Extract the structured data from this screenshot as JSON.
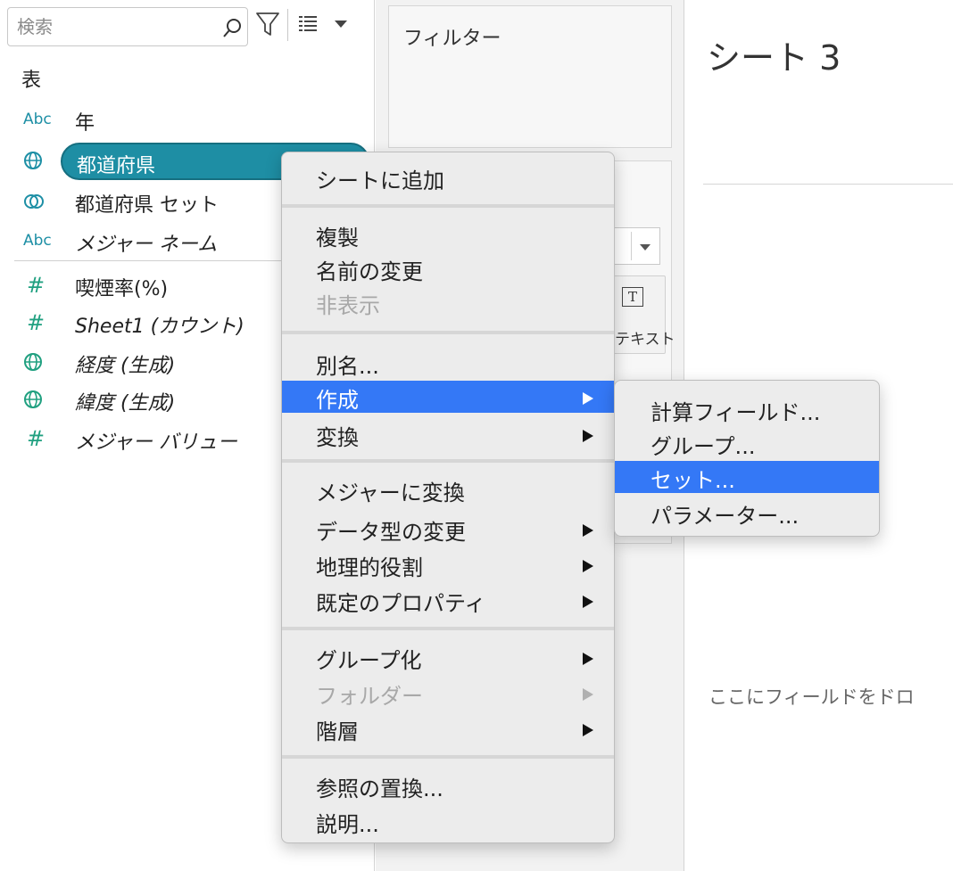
{
  "search": {
    "placeholder": "検索"
  },
  "data_pane": {
    "section_title": "表",
    "fields": [
      {
        "icon": "Abc",
        "label": "年",
        "italic": false
      },
      {
        "icon": "globe",
        "label": "都道府県",
        "italic": false,
        "selected": true
      },
      {
        "icon": "set",
        "label": "都道府県 セット",
        "italic": false
      },
      {
        "icon": "Abc",
        "label": "メジャー ネーム",
        "italic": true
      },
      {
        "icon": "#",
        "label": "喫煙率(%)",
        "italic": false
      },
      {
        "icon": "#",
        "label": "Sheet1 (カウント)",
        "italic": true
      },
      {
        "icon": "globe",
        "label": "経度 (生成)",
        "italic": true
      },
      {
        "icon": "globe",
        "label": "緯度 (生成)",
        "italic": true
      },
      {
        "icon": "#",
        "label": "メジャー バリュー",
        "italic": true
      }
    ]
  },
  "middle_pane": {
    "filters_title": "フィルター",
    "text_mark_icon": "T",
    "text_mark_label": "テキスト"
  },
  "view": {
    "sheet_title": "シート 3",
    "drop_hint": "ここにフィールドをドロ"
  },
  "context_menu": {
    "items": [
      {
        "label": "シートに追加"
      },
      {
        "label": "複製"
      },
      {
        "label": "名前の変更"
      },
      {
        "label": "非表示",
        "disabled": true
      },
      {
        "label": "別名..."
      },
      {
        "label": "作成",
        "submenu": true,
        "highlighted": true
      },
      {
        "label": "変換",
        "submenu": true
      },
      {
        "label": "メジャーに変換"
      },
      {
        "label": "データ型の変更",
        "submenu": true
      },
      {
        "label": "地理的役割",
        "submenu": true
      },
      {
        "label": "既定のプロパティ",
        "submenu": true
      },
      {
        "label": "グループ化",
        "submenu": true
      },
      {
        "label": "フォルダー",
        "submenu": true,
        "disabled": true
      },
      {
        "label": "階層",
        "submenu": true
      },
      {
        "label": "参照の置換..."
      },
      {
        "label": "説明..."
      }
    ]
  },
  "create_submenu": {
    "items": [
      {
        "label": "計算フィールド..."
      },
      {
        "label": "グループ..."
      },
      {
        "label": "セット...",
        "highlighted": true
      },
      {
        "label": "パラメーター..."
      }
    ]
  },
  "colors": {
    "accent": "#3478f6",
    "pill": "#1e8ea4",
    "dimension_icon": "#1d8fa5",
    "measure_icon": "#20a080"
  }
}
